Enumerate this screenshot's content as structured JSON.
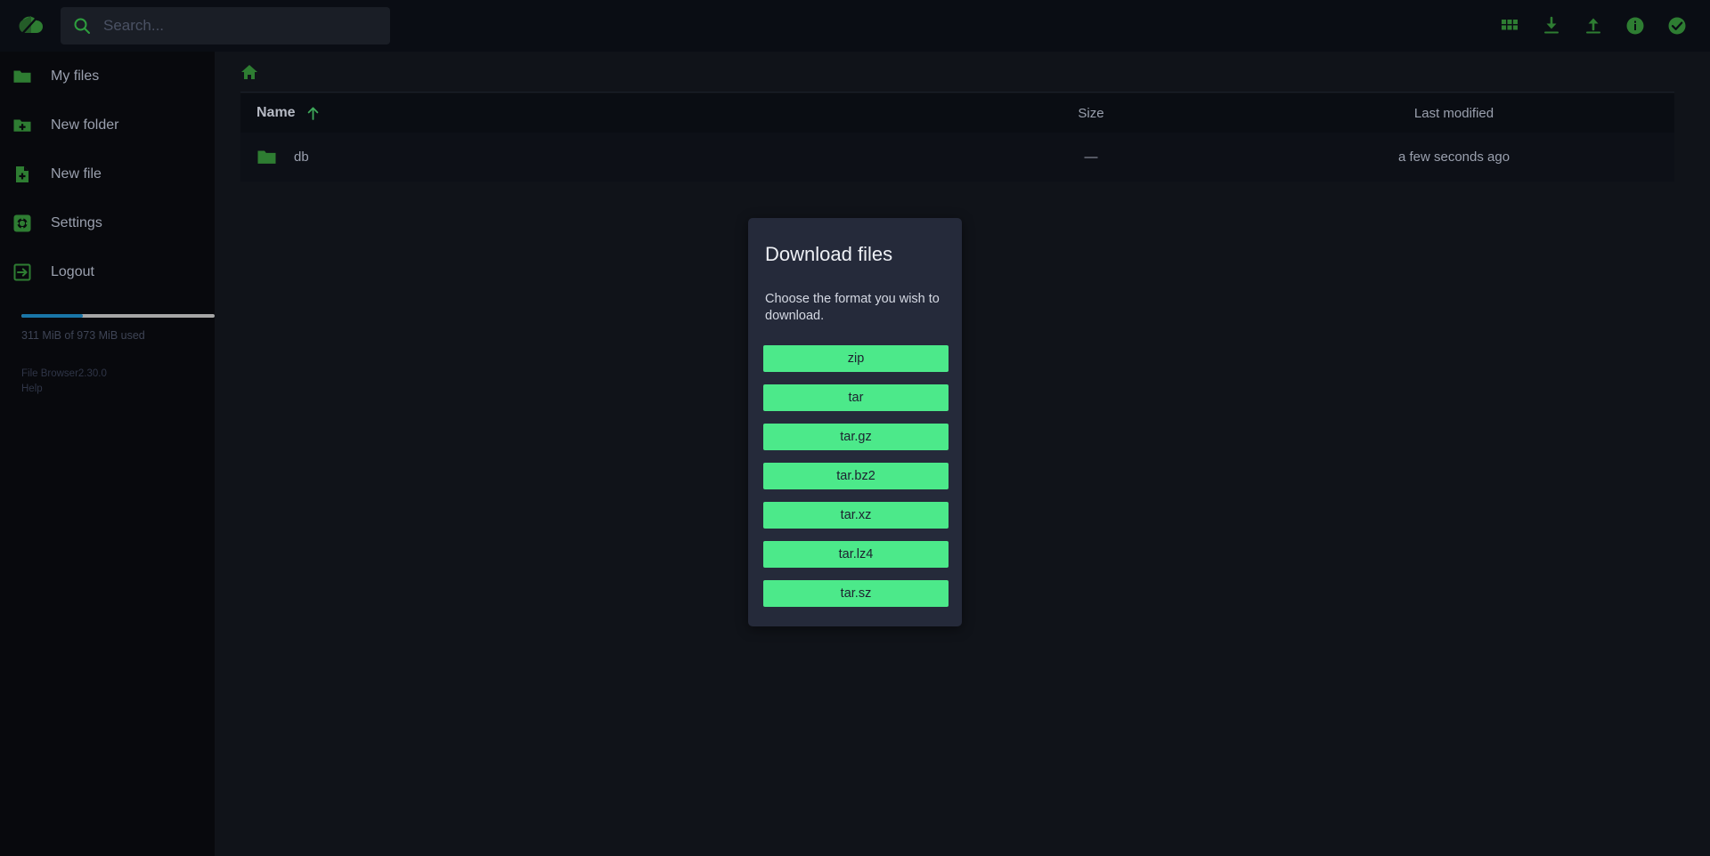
{
  "app": {
    "logo_icon": "filebrowser-logo-icon"
  },
  "search": {
    "placeholder": "Search...",
    "value": "",
    "icon": "search-icon"
  },
  "header_actions": [
    {
      "name": "switch-view-button",
      "icon": "grid-view-icon"
    },
    {
      "name": "download-button",
      "icon": "download-icon"
    },
    {
      "name": "upload-button",
      "icon": "upload-icon"
    },
    {
      "name": "info-button",
      "icon": "info-circle-icon"
    },
    {
      "name": "select-multiple-button",
      "icon": "check-circle-icon"
    }
  ],
  "sidebar": {
    "items": [
      {
        "label": "My files",
        "icon": "folder-icon"
      },
      {
        "label": "New folder",
        "icon": "folder-plus-icon"
      },
      {
        "label": "New file",
        "icon": "file-plus-icon"
      },
      {
        "label": "Settings",
        "icon": "gear-icon"
      },
      {
        "label": "Logout",
        "icon": "logout-icon"
      }
    ],
    "storage": {
      "text": "311 MiB of 973 MiB used",
      "used_percent": 32,
      "bar_color": "#1976a8",
      "track_color": "#a6a6a6"
    },
    "credits": {
      "app_name": "File Browser",
      "version": "2.30.0",
      "help_label": "Help"
    }
  },
  "breadcrumb": {
    "home_icon": "home-icon"
  },
  "listing": {
    "columns": {
      "name": "Name",
      "size": "Size",
      "modified": "Last modified"
    },
    "sort": {
      "column": "Name",
      "direction": "ascending",
      "icon": "arrow-up-icon"
    },
    "rows": [
      {
        "name": "db",
        "icon": "folder-icon",
        "size": "—",
        "modified": "a few seconds ago"
      }
    ]
  },
  "modal": {
    "title": "Download files",
    "description": "Choose the format you wish to download.",
    "button_color": "#4ce98a",
    "formats": [
      "zip",
      "tar",
      "tar.gz",
      "tar.bz2",
      "tar.xz",
      "tar.lz4",
      "tar.sz"
    ]
  },
  "theme": {
    "accent": "#2e7d32",
    "background": "#101319",
    "sidebar_background": "#08090d",
    "header_background": "#0a0d14",
    "modal_background": "#252a3a"
  }
}
